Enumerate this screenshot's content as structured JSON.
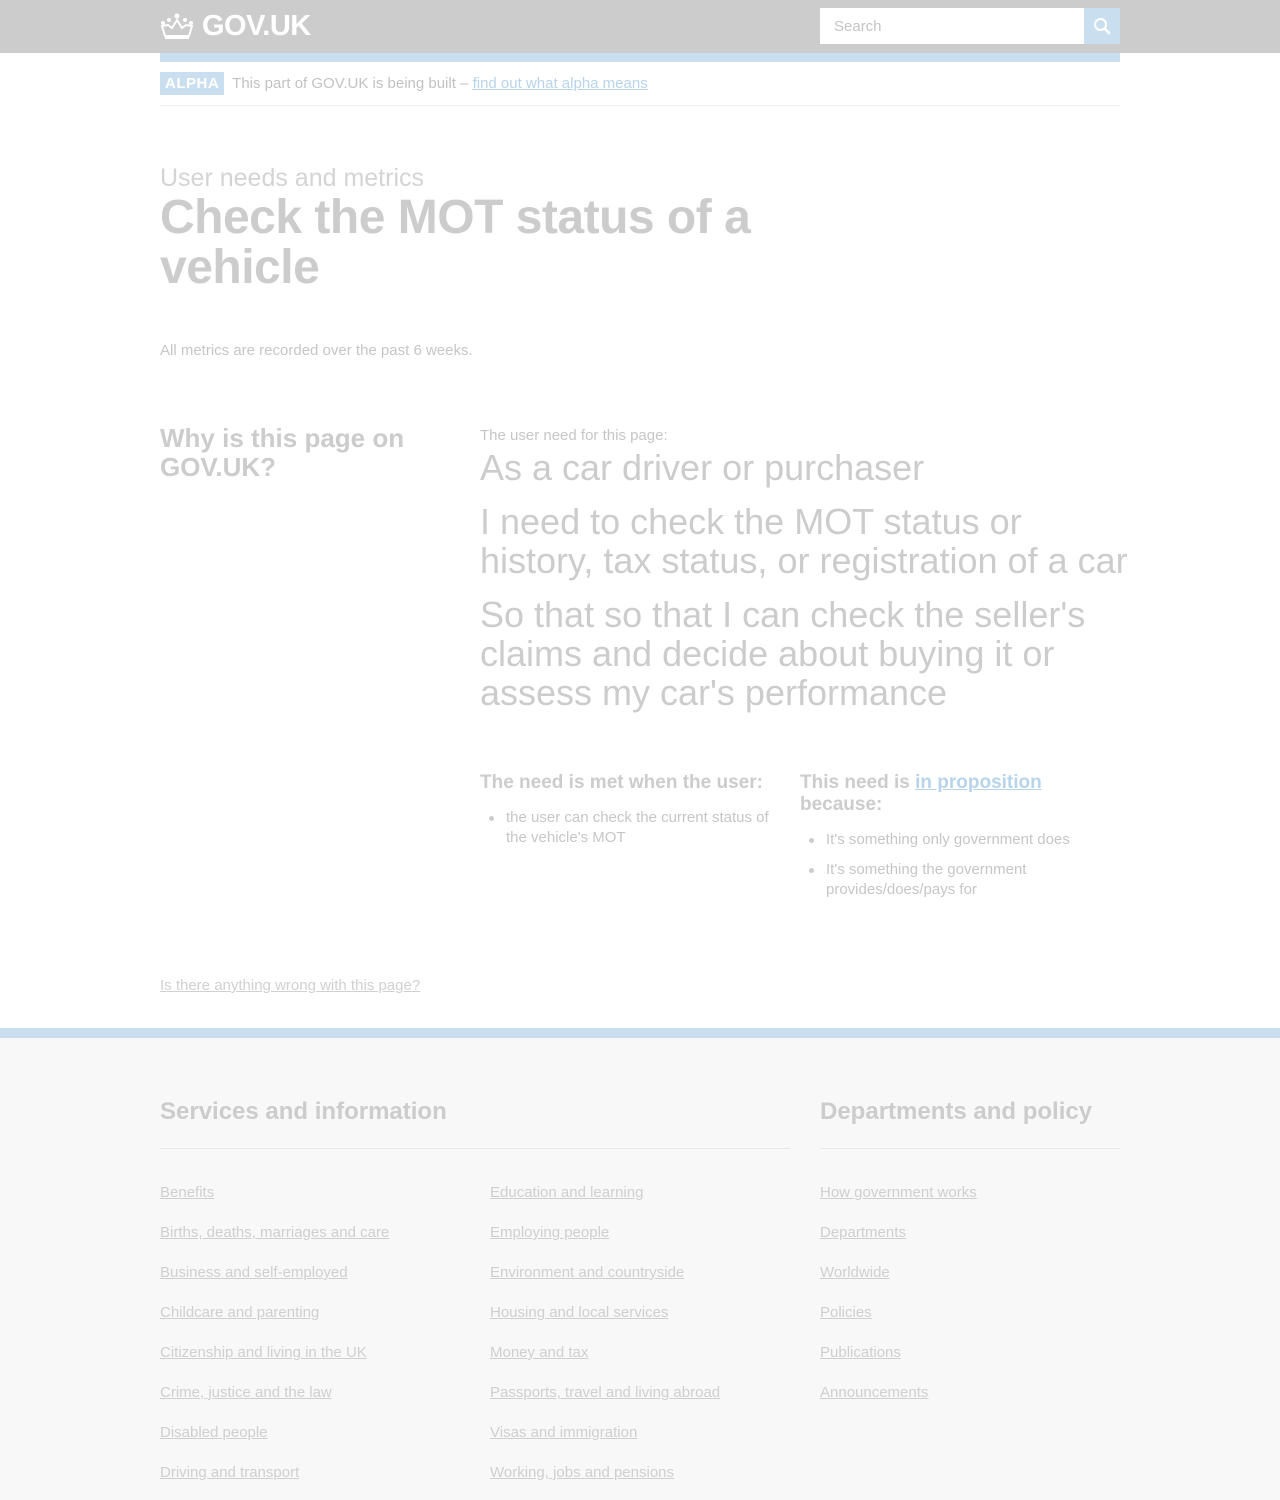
{
  "header": {
    "logo_text": "GOV.UK",
    "search_placeholder": "Search"
  },
  "phase_banner": {
    "tag": "ALPHA",
    "text": "This part of GOV.UK is being built – ",
    "link": "find out what alpha means"
  },
  "page": {
    "subtitle": "User needs and metrics",
    "title": "Check the MOT status of a vehicle",
    "metrics_note": "All metrics are recorded over the past 6 weeks."
  },
  "why": {
    "heading": "Why is this page on GOV.UK?",
    "need_label": "The user need for this page:",
    "as_a": "As a car driver or purchaser",
    "i_need": "I need to check the MOT status or history, tax status, or registration of a car",
    "so_that": "So that so that I can check the seller's claims and decide about buying it or assess my car's performance"
  },
  "need_met": {
    "heading": "The need is met when the user:",
    "items": [
      "the user can check the current status of the vehicle's MOT"
    ]
  },
  "proposition": {
    "heading_before": "This need is ",
    "heading_link": "in proposition",
    "heading_after": " because:",
    "items": [
      "It's something only government does",
      "It's something the government provides/does/pays for"
    ]
  },
  "report_link": "Is there anything wrong with this page?",
  "footer": {
    "services_heading": "Services and information",
    "departments_heading": "Departments and policy",
    "services_col1": [
      "Benefits",
      "Births, deaths, marriages and care",
      "Business and self-employed",
      "Childcare and parenting",
      "Citizenship and living in the UK",
      "Crime, justice and the law",
      "Disabled people",
      "Driving and transport"
    ],
    "services_col2": [
      "Education and learning",
      "Employing people",
      "Environment and countryside",
      "Housing and local services",
      "Money and tax",
      "Passports, travel and living abroad",
      "Visas and immigration",
      "Working, jobs and pensions"
    ],
    "departments": [
      "How government works",
      "Departments",
      "Worldwide",
      "Policies",
      "Publications",
      "Announcements"
    ]
  },
  "colors": {
    "header_bg": "#cccccc",
    "accent_blue": "#c9dff0",
    "footer_bg": "#f8f8f8"
  }
}
